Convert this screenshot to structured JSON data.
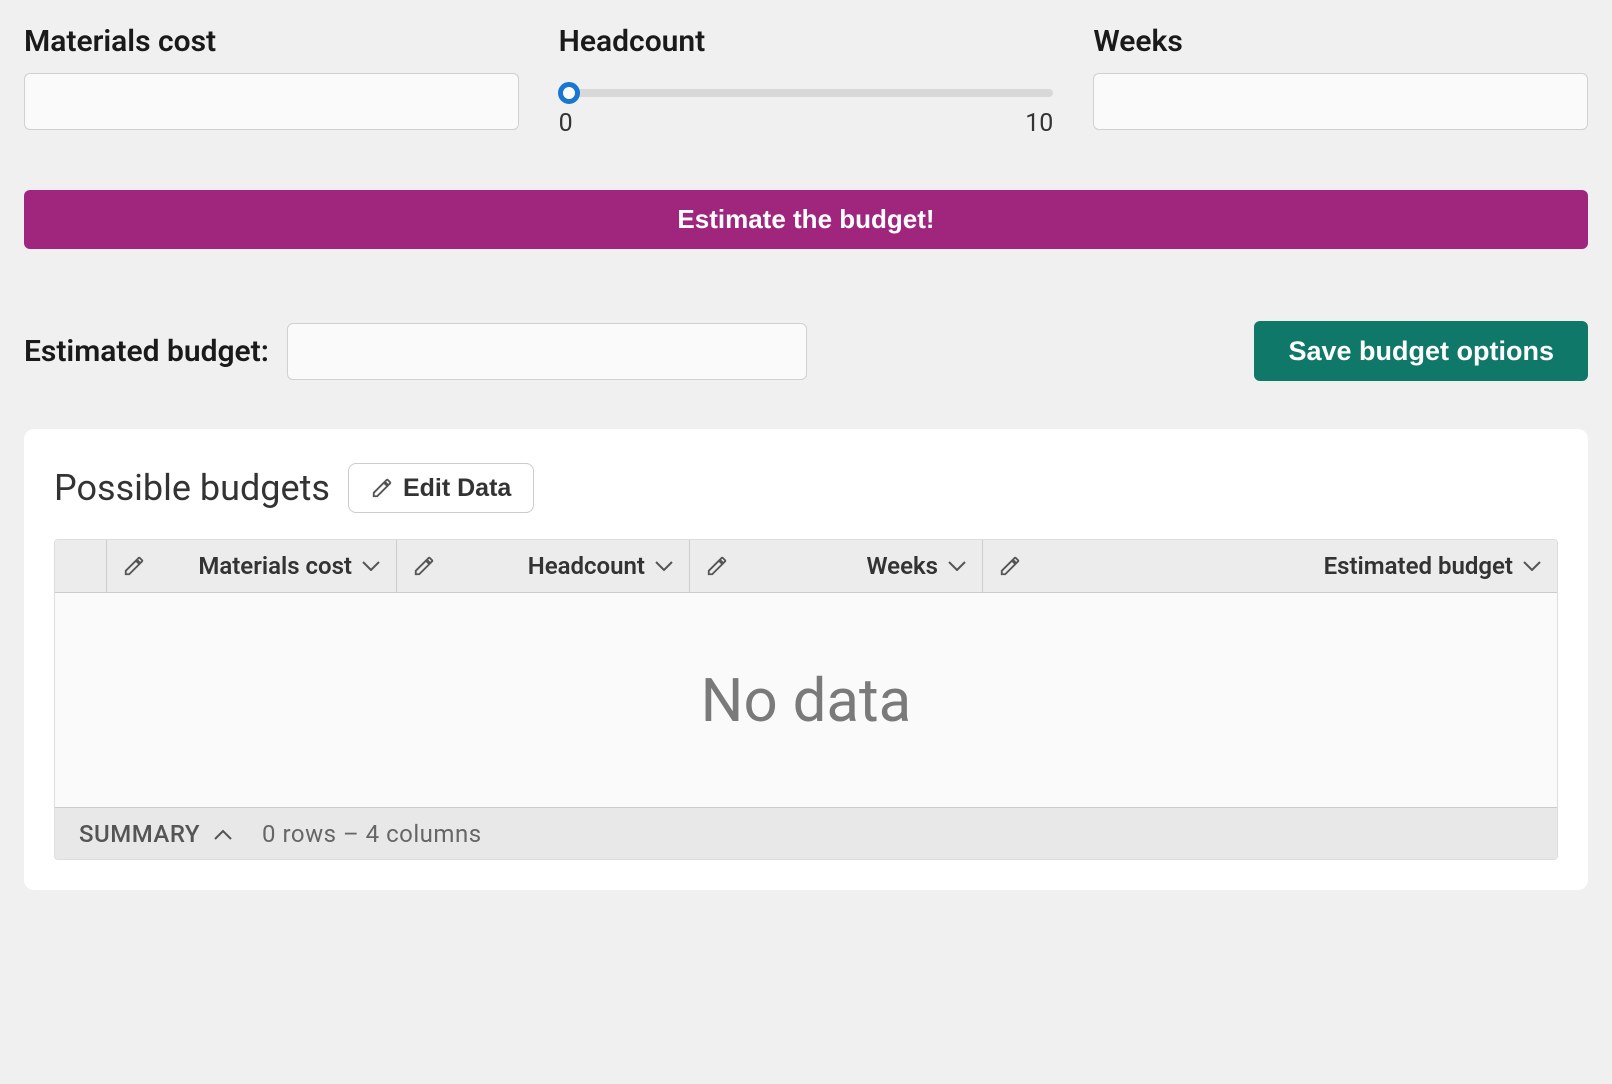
{
  "inputs": {
    "materials_cost": {
      "label": "Materials cost",
      "value": ""
    },
    "headcount": {
      "label": "Headcount",
      "min": "0",
      "max": "10",
      "value": 0
    },
    "weeks": {
      "label": "Weeks",
      "value": ""
    }
  },
  "buttons": {
    "estimate": "Estimate the budget!",
    "save": "Save budget options",
    "edit_data": "Edit Data"
  },
  "result": {
    "label": "Estimated budget:",
    "value": ""
  },
  "table": {
    "title": "Possible budgets",
    "columns": [
      "Materials cost",
      "Headcount",
      "Weeks",
      "Estimated budget"
    ],
    "empty_text": "No data",
    "summary_label": "SUMMARY",
    "summary_count": "0 rows – 4 columns"
  }
}
